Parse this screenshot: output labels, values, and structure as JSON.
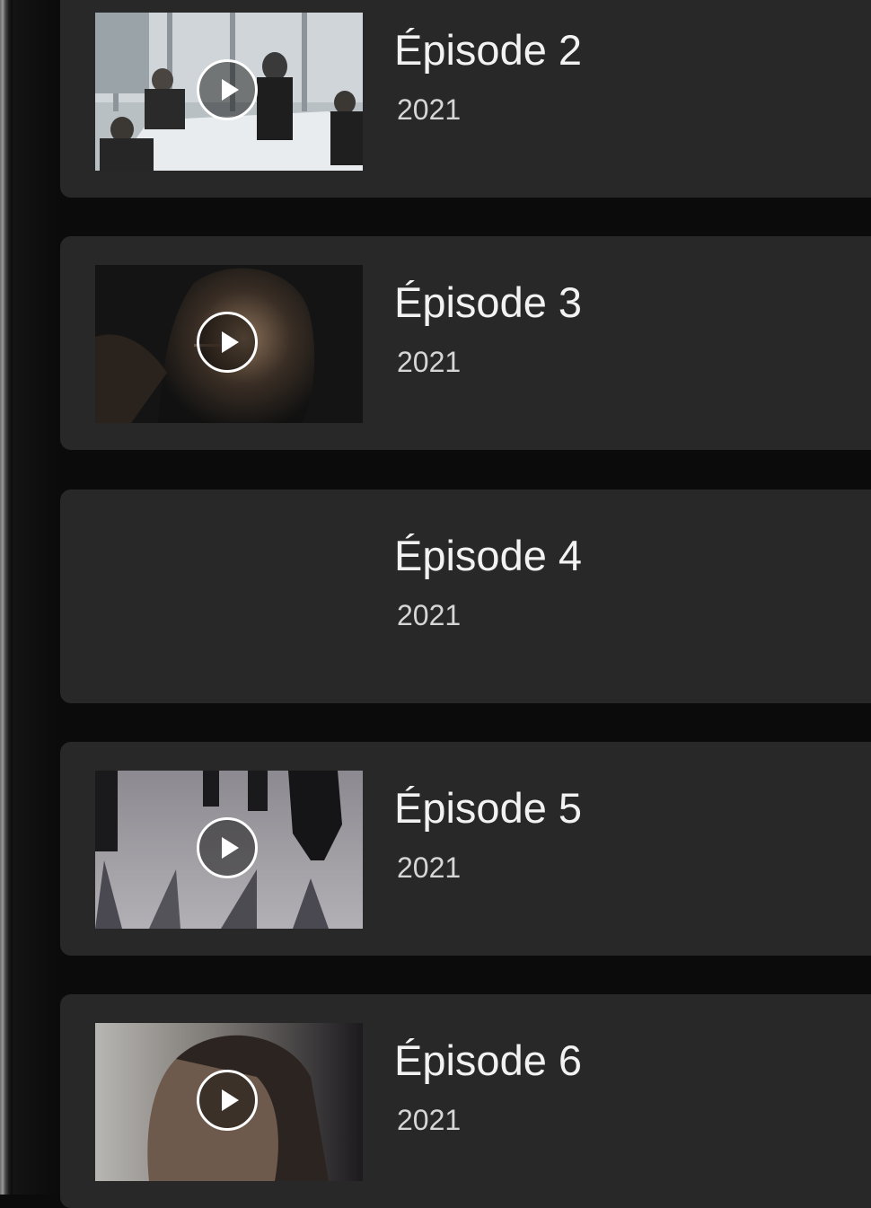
{
  "episodes": [
    {
      "title": "Épisode 2",
      "year": "2021",
      "thumbnail": "boardroom-meeting-thumbnail",
      "has_thumbnail": true
    },
    {
      "title": "Épisode 3",
      "year": "2021",
      "thumbnail": "man-portrait-thumbnail",
      "has_thumbnail": true
    },
    {
      "title": "Épisode 4",
      "year": "2021",
      "thumbnail": "",
      "has_thumbnail": false
    },
    {
      "title": "Épisode 5",
      "year": "2021",
      "thumbnail": "walking-shadows-thumbnail",
      "has_thumbnail": true
    },
    {
      "title": "Épisode 6",
      "year": "2021",
      "thumbnail": "woman-in-smoke-thumbnail",
      "has_thumbnail": true
    }
  ],
  "icons": {
    "play": "play-icon"
  },
  "colors": {
    "background": "#0b0b0b",
    "card": "#282828",
    "title": "#f2f2f2",
    "year": "#d6d6d6"
  }
}
